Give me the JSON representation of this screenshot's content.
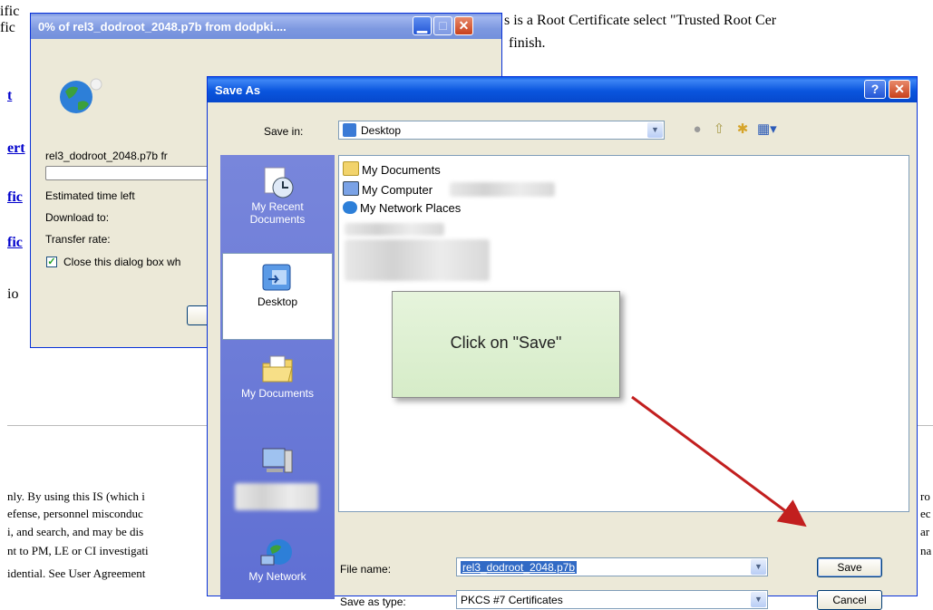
{
  "background_page": {
    "line1_left": "ific",
    "line1_right": "s is a Root Certificate select \"Trusted Root Cer",
    "line2_left": "fic",
    "line2_right": "finish.",
    "links": [
      "t",
      "ert",
      "fic",
      "fic"
    ],
    "line_io": "io",
    "footer_lines": [
      "nly. By using this IS (which i",
      "efense, personnel misconduc",
      "i, and search, and may be dis",
      "nt to PM, LE or CI investigati",
      "idential. See User Agreement"
    ],
    "right_edge": [
      "ro",
      "ec",
      "ar",
      "na"
    ]
  },
  "download_dialog": {
    "title": "0% of rel3_dodroot_2048.p7b from dodpki....",
    "filename_label": "rel3_dodroot_2048.p7b fr",
    "progress_fraction": 0,
    "estimated_label": "Estimated time left",
    "download_to_label": "Download to:",
    "transfer_rate_label": "Transfer rate:",
    "close_checkbox_label": "Close this dialog box wh",
    "close_checkbox_checked": true
  },
  "save_dialog": {
    "title": "Save As",
    "help_glyph": "?",
    "close_glyph": "✕",
    "save_in_label": "Save in:",
    "save_in_value": "Desktop",
    "places": [
      {
        "label_line1": "My Recent",
        "label_line2": "Documents"
      },
      {
        "label_line1": "Desktop",
        "label_line2": ""
      },
      {
        "label_line1": "My Documents",
        "label_line2": ""
      },
      {
        "label_line1": "",
        "label_line2": ""
      },
      {
        "label_line1": "My Network",
        "label_line2": ""
      }
    ],
    "files": [
      "My Documents",
      "My Computer",
      "My Network Places"
    ],
    "file_name_label": "File name:",
    "file_name_value": "rel3_dodroot_2048.p7b",
    "save_as_type_label": "Save as type:",
    "save_as_type_value": "PKCS #7 Certificates",
    "save_button": "Save",
    "cancel_button": "Cancel"
  },
  "callout": {
    "text": "Click on \"Save\""
  },
  "colors": {
    "xp_title_blue": "#0a55de",
    "callout_green": "#dcefd0",
    "arrow_red": "#c21f1f"
  }
}
